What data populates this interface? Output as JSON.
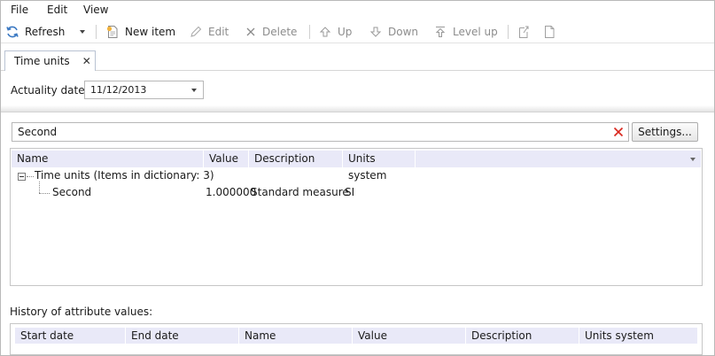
{
  "menubar": {
    "items": [
      "File",
      "Edit",
      "View"
    ]
  },
  "toolbar": {
    "refresh": "Refresh",
    "new_item": "New item",
    "edit": "Edit",
    "delete": "Delete",
    "up": "Up",
    "down": "Down",
    "level_up": "Level up"
  },
  "tab": {
    "label": "Time units"
  },
  "actuality": {
    "label": "Actuality date:",
    "value": "11/12/2013"
  },
  "search": {
    "value": "Second"
  },
  "settings_button": "Settings...",
  "grid": {
    "columns": [
      "Name",
      "Value",
      "Description",
      "Units system"
    ],
    "root_label": "Time units (Items in dictionary: 3)",
    "rows": [
      {
        "name": "Second",
        "value": "1.000000",
        "description": "Standard measure",
        "units_system": "SI"
      }
    ]
  },
  "history": {
    "label": "History of attribute values:",
    "columns": [
      "Start date",
      "End date",
      "Name",
      "Value",
      "Description",
      "Units system"
    ]
  },
  "colors": {
    "header_bg": "#e9e9f8",
    "clear_icon": "#d9261c",
    "icon_blue": "#3a78c2"
  }
}
